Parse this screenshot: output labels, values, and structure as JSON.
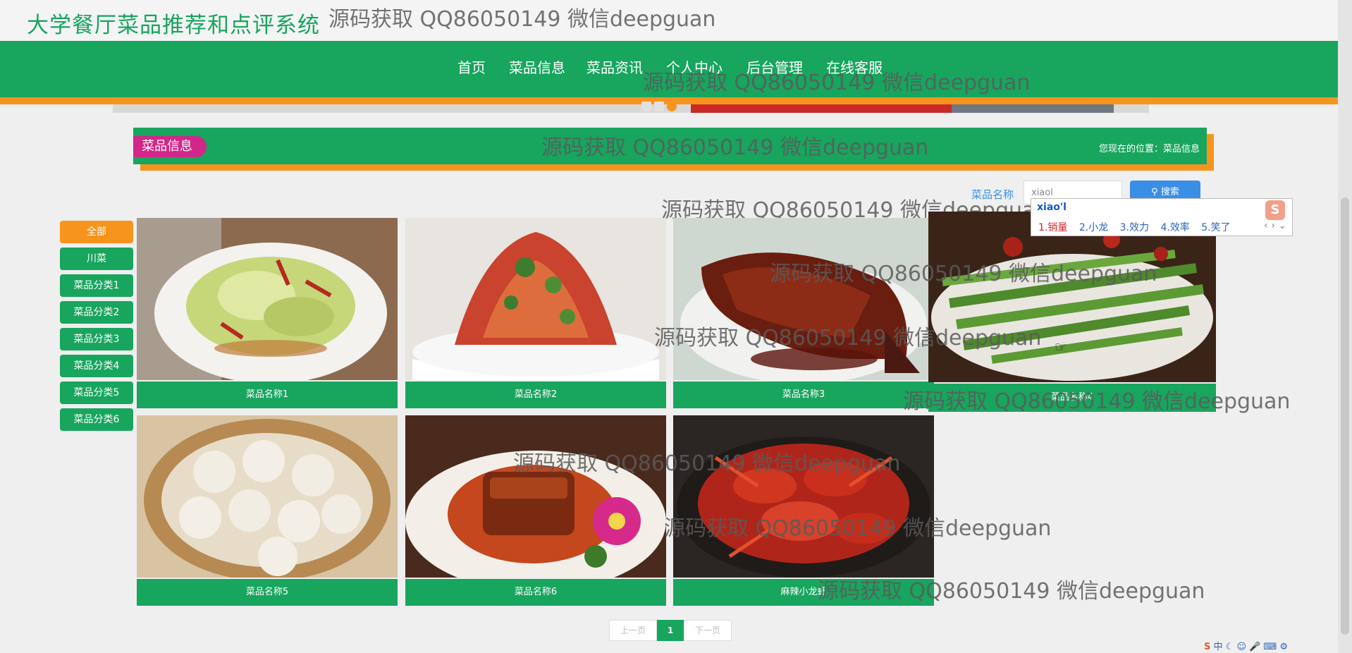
{
  "site": {
    "title": "大学餐厅菜品推荐和点评系统"
  },
  "watermark": "源码获取 QQ86050149 微信deepguan",
  "nav": [
    {
      "label": "首页"
    },
    {
      "label": "菜品信息"
    },
    {
      "label": "菜品资讯"
    },
    {
      "label": "个人中心"
    },
    {
      "label": "后台管理"
    },
    {
      "label": "在线客服"
    }
  ],
  "section": {
    "title": "菜品信息",
    "breadcrumb": "您现在的位置：菜品信息"
  },
  "search": {
    "label": "菜品名称",
    "value": "xiaol",
    "button": "搜索",
    "ime_composition": "xiao'l",
    "ime_candidates": [
      "1.销量",
      "2.小龙",
      "3.效力",
      "4.效率",
      "5.笑了"
    ]
  },
  "categories": [
    {
      "label": "全部",
      "active": true
    },
    {
      "label": "川菜"
    },
    {
      "label": "菜品分类1"
    },
    {
      "label": "菜品分类2"
    },
    {
      "label": "菜品分类3"
    },
    {
      "label": "菜品分类4"
    },
    {
      "label": "菜品分类5"
    },
    {
      "label": "菜品分类6"
    }
  ],
  "dishes": [
    {
      "name": "菜品名称1",
      "icon": "cabbage-dish-image"
    },
    {
      "name": "菜品名称2",
      "icon": "spicy-salad-image"
    },
    {
      "name": "菜品名称3",
      "icon": "braised-fish-image"
    },
    {
      "name": "菜品名称4",
      "icon": "green-beans-image"
    },
    {
      "name": "菜品名称5",
      "icon": "soup-dumplings-image"
    },
    {
      "name": "菜品名称6",
      "icon": "braised-pork-image"
    },
    {
      "name": "麻辣小龙虾",
      "icon": "crayfish-image"
    }
  ],
  "pagination": {
    "prev": "上一页",
    "current": "1",
    "next": "下一页"
  },
  "taskbar": {
    "ime_status": "中"
  },
  "colors": {
    "primary": "#18a55e",
    "accent": "#f7941d",
    "pill": "#d3268a",
    "link": "#3a8ee6"
  }
}
